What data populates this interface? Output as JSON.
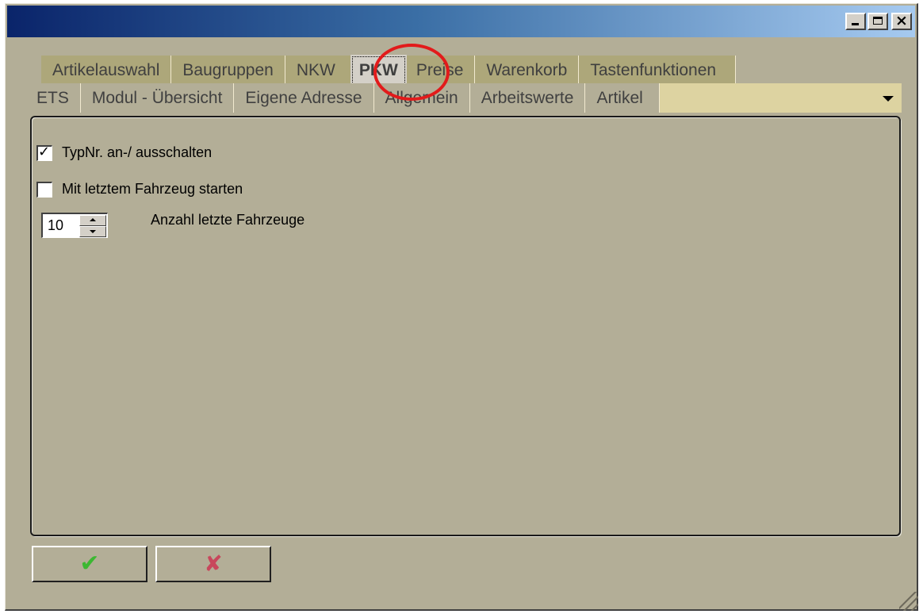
{
  "window": {
    "title": "",
    "caption": {
      "minimize": "_",
      "maximize": "□",
      "close": "×"
    }
  },
  "tabs": {
    "back_row": [
      {
        "label": "Artikelauswahl"
      },
      {
        "label": "Baugruppen"
      },
      {
        "label": "NKW"
      },
      {
        "label": "PKW",
        "active": true
      },
      {
        "label": "Preise"
      },
      {
        "label": "Warenkorb"
      },
      {
        "label": "Tastenfunktionen"
      }
    ],
    "front_row": [
      {
        "label": "ETS"
      },
      {
        "label": "Modul - Übersicht"
      },
      {
        "label": "Eigene Adresse"
      },
      {
        "label": "Allgemein"
      },
      {
        "label": "Arbeitswerte"
      },
      {
        "label": "Artikel"
      }
    ]
  },
  "options": {
    "typnr": {
      "label": "TypNr. an-/ ausschalten",
      "checked": true,
      "mark": "✓"
    },
    "last_vehicle": {
      "label": "Mit letztem Fahrzeug starten",
      "checked": false
    },
    "count": {
      "value": "10",
      "label": "Anzahl letzte Fahrzeuge"
    }
  },
  "buttons": {
    "ok_glyph": "✔",
    "cancel_glyph": "✘"
  },
  "colors": {
    "window_bg": "#b3ae97",
    "tab_front_bg": "#ddd3a1",
    "highlight": "#e21b1b"
  },
  "icons": [
    "minimize-icon",
    "maximize-icon",
    "close-icon",
    "dropdown-arrow-icon",
    "checkmark-icon",
    "cross-icon",
    "resize-grip-icon"
  ]
}
